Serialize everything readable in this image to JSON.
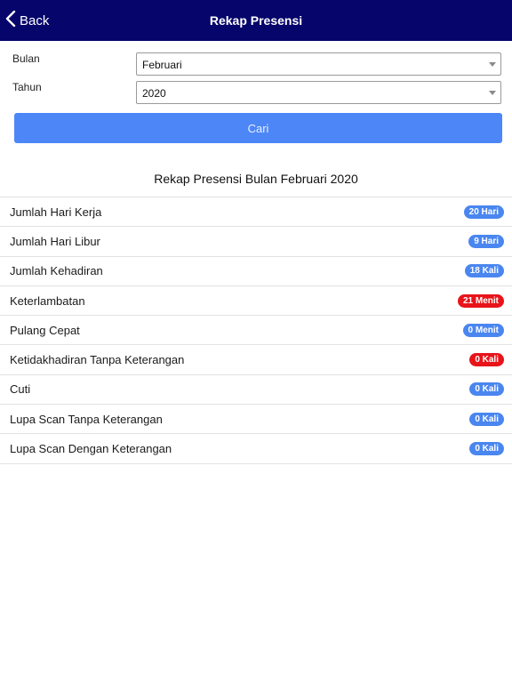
{
  "header": {
    "back_label": "Back",
    "title": "Rekap Presensi"
  },
  "form": {
    "bulan_label": "Bulan",
    "bulan_value": "Februari",
    "tahun_label": "Tahun",
    "tahun_value": "2020",
    "search_button": "Cari"
  },
  "summary": {
    "title": "Rekap Presensi Bulan Februari 2020",
    "items": [
      {
        "label": "Jumlah Hari Kerja",
        "value": "20 Hari",
        "color": "#4a86f0"
      },
      {
        "label": "Jumlah Hari Libur",
        "value": "9 Hari",
        "color": "#4a86f0"
      },
      {
        "label": "Jumlah Kehadiran",
        "value": "18 Kali",
        "color": "#4a86f0"
      },
      {
        "label": "Keterlambatan",
        "value": "21 Menit",
        "color": "#e8141a"
      },
      {
        "label": "Pulang Cepat",
        "value": "0 Menit",
        "color": "#4a86f0"
      },
      {
        "label": "Ketidakhadiran Tanpa Keterangan",
        "value": "0 Kali",
        "color": "#e8141a"
      },
      {
        "label": "Cuti",
        "value": "0 Kali",
        "color": "#4a86f0"
      },
      {
        "label": "Lupa Scan Tanpa Keterangan",
        "value": "0 Kali",
        "color": "#4a86f0"
      },
      {
        "label": "Lupa Scan Dengan Keterangan",
        "value": "0 Kali",
        "color": "#4a86f0"
      }
    ]
  },
  "theme": {
    "navbar": "#05056b",
    "button": "#4d86f7",
    "badge_blue": "#4a86f0",
    "badge_red": "#e8141a"
  }
}
